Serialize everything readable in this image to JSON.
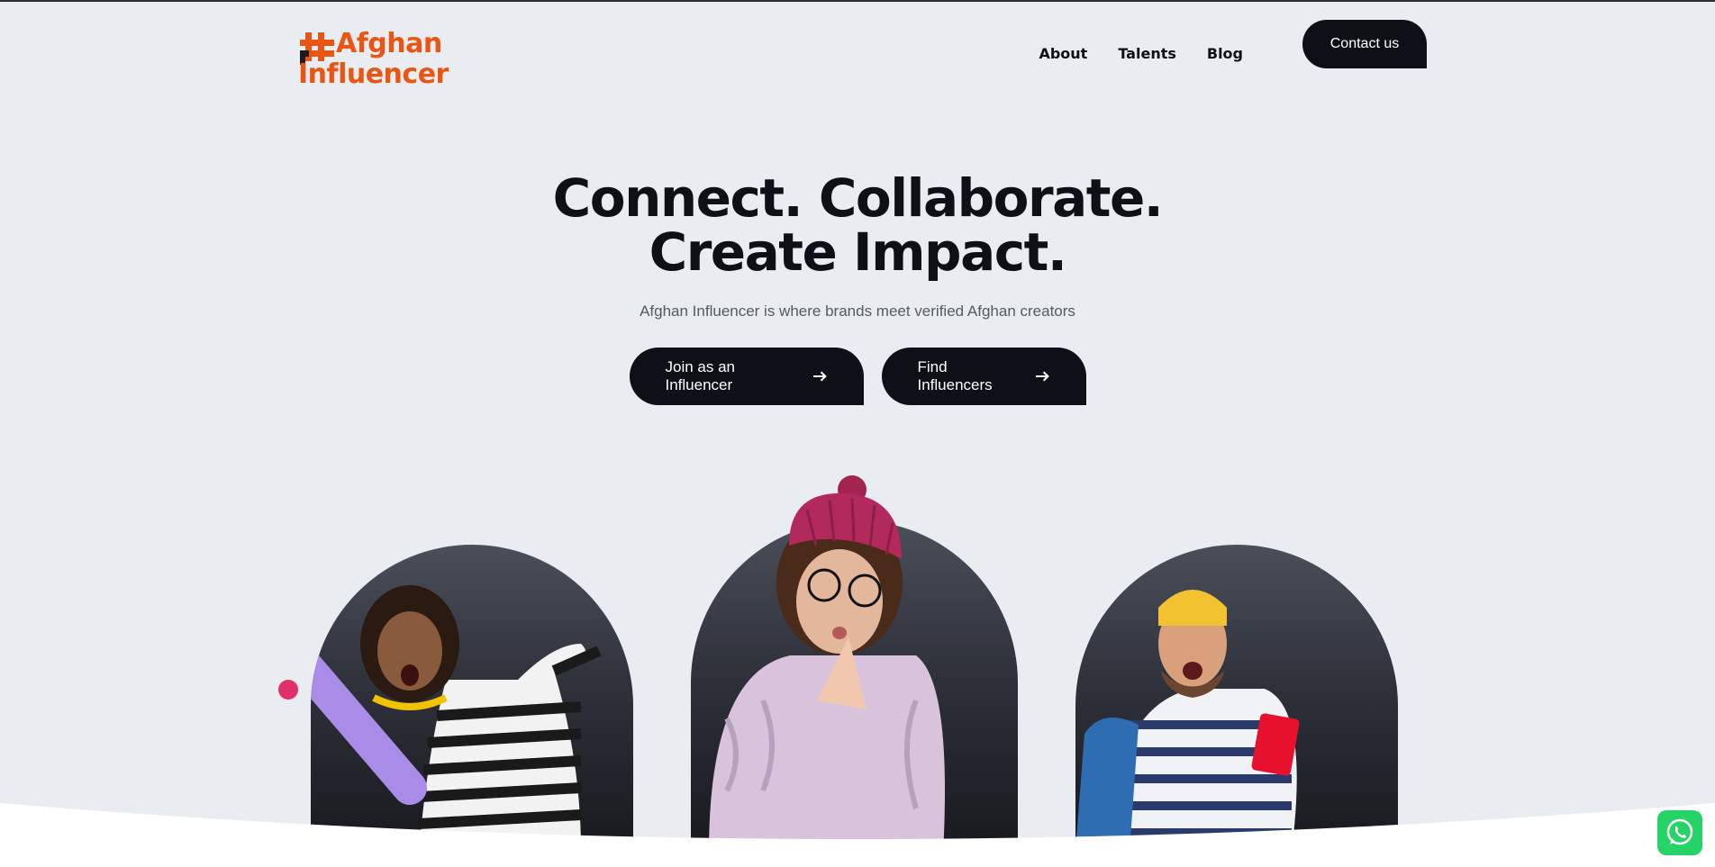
{
  "header": {
    "logo_line1": "Afghan",
    "logo_line2": "Influencer",
    "nav": [
      {
        "label": "About"
      },
      {
        "label": "Talents"
      },
      {
        "label": "Blog"
      }
    ],
    "contact_label": "Contact us"
  },
  "hero": {
    "title_line1": "Connect. Collaborate.",
    "title_line2": "Create Impact.",
    "subtitle": "Afghan Influencer is where brands meet verified Afghan creators",
    "cta_join": "Join as an Influencer",
    "cta_find": "Find Influencers"
  },
  "colors": {
    "brand_orange": "#ea5514",
    "dark": "#0d1117",
    "background": "#e9ecf0",
    "whatsapp": "#25d366"
  },
  "icons": [
    "hash-logo-icon",
    "arrow-right-icon",
    "whatsapp-icon"
  ]
}
